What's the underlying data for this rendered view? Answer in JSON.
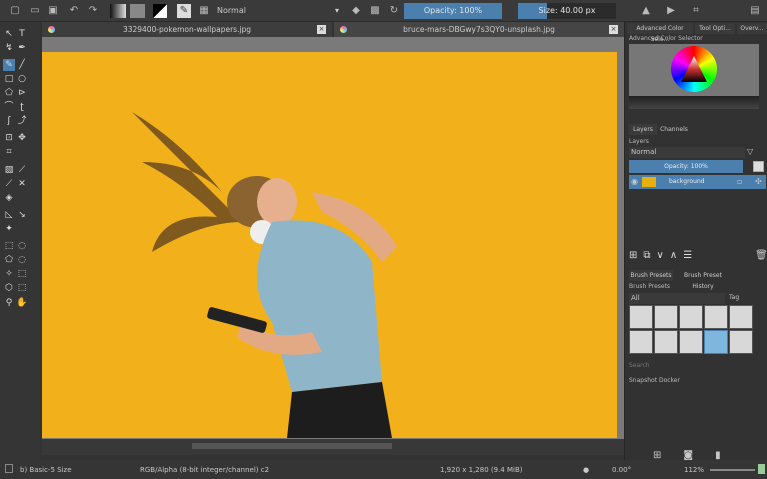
{
  "toolbar": {
    "blend_mode": "Normal",
    "opacity": "Opacity: 100%",
    "opacity_value": 100,
    "size": "Size: 40.00 px",
    "size_fraction": 0.3
  },
  "tabs": [
    {
      "label": "3329400-pokemon-wallpapers.jpg",
      "active": false
    },
    {
      "label": "bruce-mars-DBGwy7s3QY0-unsplash.jpg",
      "active": true
    }
  ],
  "right_panel": {
    "top_tabs": [
      "Advanced Color Sele...",
      "Tool Opti...",
      "Overv..."
    ],
    "color_selector_title": "Advanced Color Selector",
    "layer_tabs": [
      "Layers",
      "Channels"
    ],
    "layers_title": "Layers",
    "layer_blend": "Normal",
    "layer_opacity": "Opacity: 100%",
    "layers": [
      {
        "name": "background"
      }
    ],
    "brush_tabs": [
      "Brush Presets",
      "Brush Preset History"
    ],
    "brush_title": "Brush Presets",
    "brush_filter": "All",
    "tag_label": "Tag",
    "search_placeholder": "Search",
    "snapshot_title": "Snapshot Docker"
  },
  "status": {
    "brush": "b) Basic-5 Size",
    "color_space": "RGB/Alpha (8-bit integer/channel)  c2",
    "dimensions": "1,920 x 1,280 (9.4 MiB)",
    "rotation": "0.00°",
    "zoom": "112%"
  },
  "colors": {
    "accent": "#4a7fae",
    "background_yellow": "#f2b11a"
  }
}
